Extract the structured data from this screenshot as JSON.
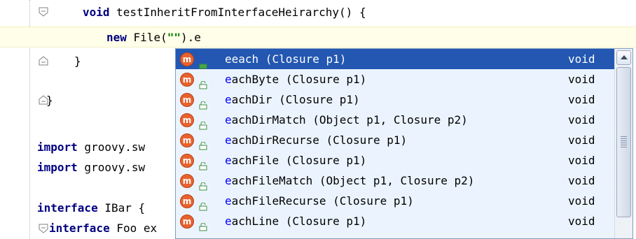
{
  "editor": {
    "lines": [
      {
        "kw": "void",
        "rest": " testInheritFromInterfaceHeirarchy() {"
      },
      {
        "kw": "new",
        "mid": " File(",
        "str": "\"\"",
        "rest": ").e"
      },
      {
        "text": "}"
      },
      {
        "text": "}"
      },
      {
        "kw": "import",
        "rest": " groovy.sw"
      },
      {
        "kw": "import",
        "rest": " groovy.sw"
      },
      {
        "kw": "interface",
        "rest": " IBar {"
      },
      {
        "kw": "interface",
        "rest": " Foo ex"
      }
    ]
  },
  "completion": {
    "items": [
      {
        "icon": "m",
        "prefix": "e",
        "name": "each",
        "params": " (Closure p1)",
        "type": "void",
        "selected": true
      },
      {
        "icon": "m",
        "prefix": "e",
        "name": "achByte",
        "params": " (Closure p1)",
        "type": "void"
      },
      {
        "icon": "m",
        "prefix": "e",
        "name": "achDir",
        "params": " (Closure p1)",
        "type": "void"
      },
      {
        "icon": "m",
        "prefix": "e",
        "name": "achDirMatch",
        "params": " (Object p1, Closure p2)",
        "type": "void"
      },
      {
        "icon": "m",
        "prefix": "e",
        "name": "achDirRecurse",
        "params": " (Closure p1)",
        "type": "void"
      },
      {
        "icon": "m",
        "prefix": "e",
        "name": "achFile",
        "params": " (Closure p1)",
        "type": "void"
      },
      {
        "icon": "m",
        "prefix": "e",
        "name": "achFileMatch",
        "params": " (Object p1, Closure p2)",
        "type": "void"
      },
      {
        "icon": "m",
        "prefix": "e",
        "name": "achFileRecurse",
        "params": " (Closure p1)",
        "type": "void"
      },
      {
        "icon": "m",
        "prefix": "e",
        "name": "achLine",
        "params": " (Closure p1)",
        "type": "void"
      }
    ]
  }
}
